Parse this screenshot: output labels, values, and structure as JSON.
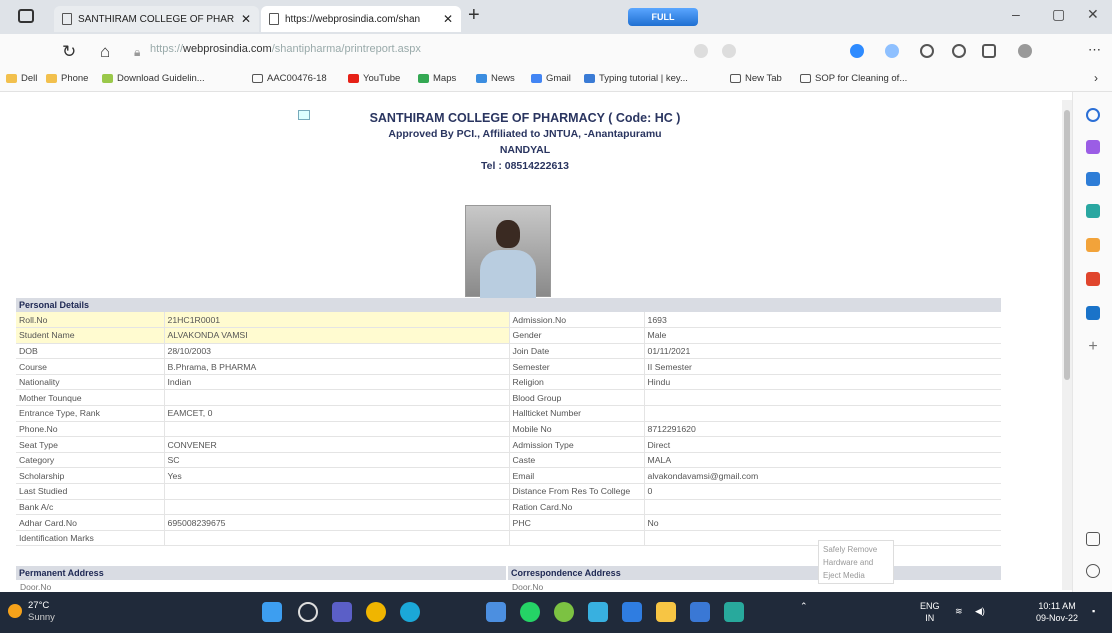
{
  "browser": {
    "tabs": [
      {
        "label": "SANTHIRAM COLLEGE OF PHAR"
      },
      {
        "label": "https://webprosindia.com/shan"
      }
    ],
    "full_badge": "FULL",
    "url_prefix": "https://",
    "url_domain": "webprosindia.com",
    "url_path": "/shantipharma/printreport.aspx",
    "bookmarks": [
      "Dell",
      "Phone",
      "Download Guidelin...",
      "AAC00476-18",
      "YouTube",
      "Maps",
      "News",
      "Gmail",
      "Typing tutorial | key...",
      "New Tab",
      "SOP for Cleaning of..."
    ]
  },
  "header": {
    "college": "SANTHIRAM COLLEGE OF PHARMACY ( Code: HC )",
    "affiliation": "Approved By PCI., Affiliated to JNTUA, -Anantapuramu",
    "city": "NANDYAL",
    "tel": "Tel : 08514222613"
  },
  "personal_details_title": "Personal Details",
  "rows": [
    {
      "l1": "Roll.No",
      "v1": "21HC1R0001",
      "l2": "Admission.No",
      "v2": "1693"
    },
    {
      "l1": "Student Name",
      "v1": "ALVAKONDA VAMSI",
      "l2": "Gender",
      "v2": "Male"
    },
    {
      "l1": "DOB",
      "v1": "28/10/2003",
      "l2": "Join Date",
      "v2": "01/11/2021"
    },
    {
      "l1": "Course",
      "v1": "B.Phrama, B PHARMA",
      "l2": "Semester",
      "v2": "II Semester"
    },
    {
      "l1": "Nationality",
      "v1": "Indian",
      "l2": "Religion",
      "v2": "Hindu"
    },
    {
      "l1": "Mother Tounque",
      "v1": "",
      "l2": "Blood Group",
      "v2": ""
    },
    {
      "l1": "Entrance Type, Rank",
      "v1": "EAMCET, 0",
      "l2": "Hallticket Number",
      "v2": ""
    },
    {
      "l1": "Phone.No",
      "v1": "",
      "l2": "Mobile No",
      "v2": "8712291620"
    },
    {
      "l1": "Seat Type",
      "v1": "CONVENER",
      "l2": "Admission Type",
      "v2": "Direct"
    },
    {
      "l1": "Category",
      "v1": "SC",
      "l2": "Caste",
      "v2": "MALA"
    },
    {
      "l1": "Scholarship",
      "v1": "Yes",
      "l2": "Email",
      "v2": "alvakondavamsi@gmail.com"
    },
    {
      "l1": "Last Studied",
      "v1": "",
      "l2": "Distance From Res To College",
      "v2": "0"
    },
    {
      "l1": "Bank A/c",
      "v1": "",
      "l2": "Ration Card.No",
      "v2": ""
    },
    {
      "l1": "Adhar Card.No",
      "v1": "695008239675",
      "l2": "PHC",
      "v2": "No"
    },
    {
      "l1": "Identification Marks",
      "v1": "",
      "l2": "",
      "v2": ""
    }
  ],
  "permanent_address_title": "Permanent Address",
  "correspondence_address_title": "Correspondence Address",
  "door_no_label": "Door.No",
  "popup_lines": [
    "Safely Remove",
    "Hardware and",
    "Eject Media"
  ],
  "taskbar": {
    "temp": "27°C",
    "condition": "Sunny",
    "lang": "ENG",
    "region": "IN",
    "time": "10:11 AM",
    "date": "09-Nov-22"
  }
}
